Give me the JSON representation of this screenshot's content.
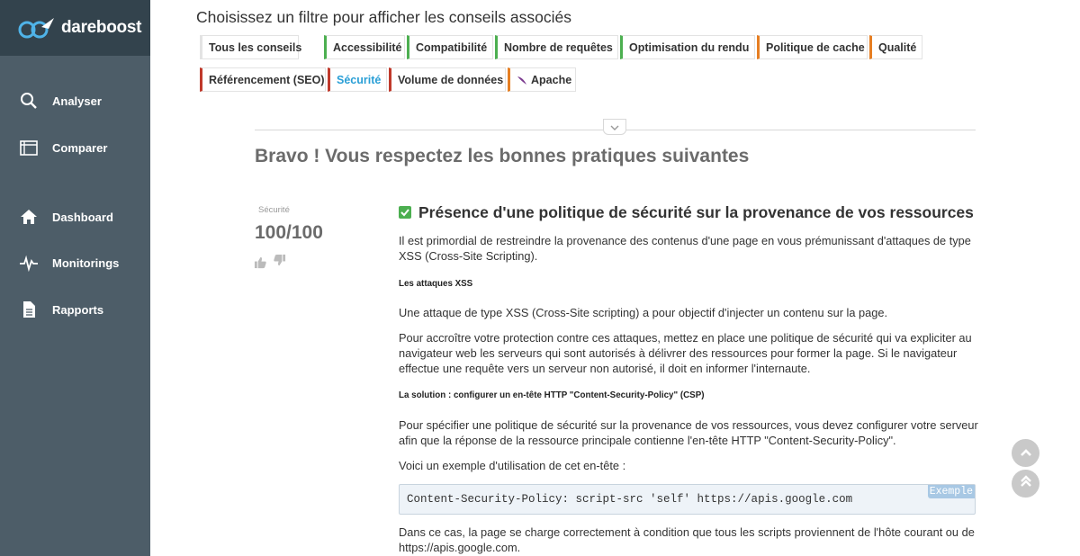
{
  "app": {
    "logo_text": "dareboost"
  },
  "sidebar": {
    "items": [
      {
        "label": "Analyser",
        "icon": "search-icon"
      },
      {
        "label": "Comparer",
        "icon": "compare-icon"
      },
      {
        "label": "Dashboard",
        "icon": "home-icon"
      },
      {
        "label": "Monitorings",
        "icon": "pulse-icon"
      },
      {
        "label": "Rapports",
        "icon": "document-icon"
      }
    ]
  },
  "filters": {
    "title": "Choisissez un filtre pour afficher les conseils associés",
    "chips": [
      {
        "label": "Tous les conseils",
        "color": "#e3e3e3"
      },
      {
        "label": "Accessibilité",
        "color": "#4caf50"
      },
      {
        "label": "Compatibilité",
        "color": "#4caf50"
      },
      {
        "label": "Nombre de requêtes",
        "color": "#4caf50"
      },
      {
        "label": "Optimisation du rendu",
        "color": "#4caf50"
      },
      {
        "label": "Politique de cache",
        "color": "#e67e22"
      },
      {
        "label": "Qualité",
        "color": "#e67e22"
      },
      {
        "label": "Référencement (SEO)",
        "color": "#c0392b"
      },
      {
        "label": "Sécurité",
        "color": "#c0392b",
        "active": true
      },
      {
        "label": "Volume de données",
        "color": "#c0392b"
      },
      {
        "label": "Apache",
        "color": "#e67e22"
      }
    ]
  },
  "main": {
    "section_heading": "Bravo ! Vous respectez les bonnes pratiques suivantes",
    "rule": {
      "category": "Sécurité",
      "score": "100/100",
      "title": "Présence d'une politique de sécurité sur la provenance de vos ressources",
      "intro": "Il est primordial de restreindre la provenance des contenus d'une page en vous prémunissant d'attaques de type XSS (Cross-Site Scripting).",
      "heading_xss": "Les attaques XSS",
      "xss_text": "Une attaque de type XSS (Cross-Site scripting) a pour objectif d'injecter un contenu sur la page.",
      "protect_text": "Pour accroître votre protection contre ces attaques, mettez en place une politique de sécurité qui va expliciter au navigateur web les serveurs qui sont autorisés à délivrer des ressources pour former la page. Si le navigateur effectue une requête vers un serveur non autorisé, il doit en informer l'internaute.",
      "heading_solution": "La solution : configurer un en-tête HTTP \"Content-Security-Policy\" (CSP)",
      "solution_text": "Pour spécifier une politique de sécurité sur la provenance de vos ressources, vous devez configurer votre serveur afin que la réponse de la ressource principale contienne l'en-tête HTTP \"Content-Security-Policy\".",
      "example_intro": "Voici un exemple d'utilisation de cet en-tête :",
      "code": "Content-Security-Policy: script-src 'self' https://apis.google.com",
      "code_badge": "Exemple",
      "closing_text": "Dans ce cas, la page se charge correctement à condition que tous les scripts proviennent de l'hôte courant ou de https://apis.google.com."
    }
  },
  "colors": {
    "sidebar": "#4d5d68",
    "logo_bar": "#33434d",
    "accent": "#2a9fd6",
    "success": "#4caf50"
  }
}
